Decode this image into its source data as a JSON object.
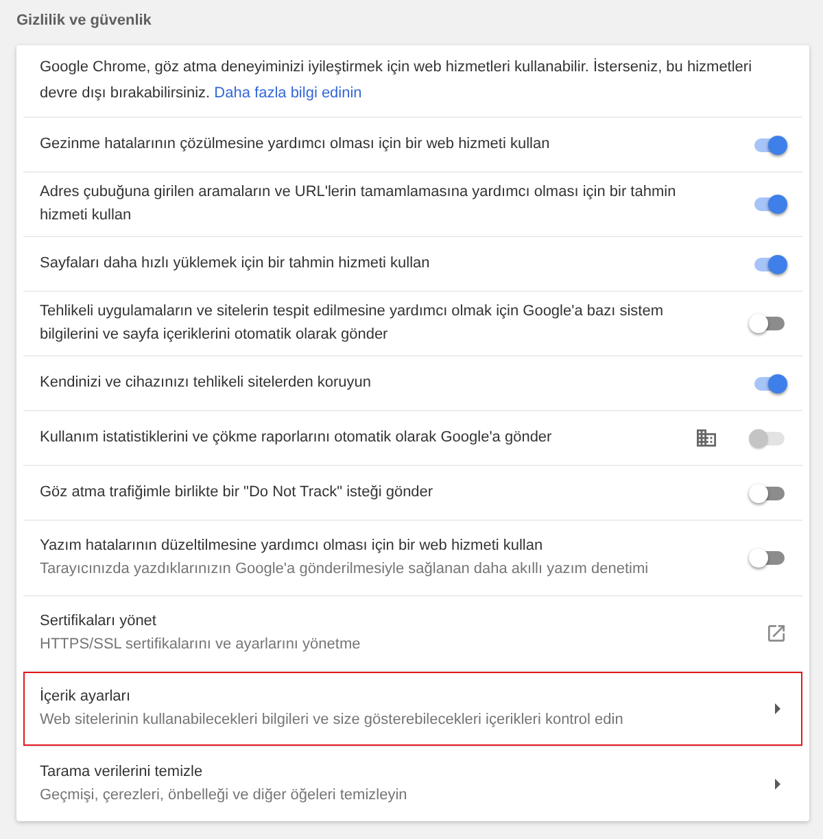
{
  "section": {
    "title": "Gizlilik ve güvenlik"
  },
  "intro": {
    "text": "Google Chrome, göz atma deneyiminizi iyileştirmek için web hizmetleri kullanabilir. İsterseniz, bu hizmetleri devre dışı bırakabilirsiniz.",
    "link": "Daha fazla bilgi edinin"
  },
  "rows": [
    {
      "kind": "toggle",
      "label": "Gezinme hatalarının çözülmesine yardımcı olması için bir web hizmeti kullan",
      "on": true,
      "disabled": false,
      "managed": false,
      "highlighted": false
    },
    {
      "kind": "toggle",
      "label": "Adres çubuğuna girilen aramaların ve URL'lerin tamamlamasına yardımcı olması için bir tahmin hizmeti kullan",
      "on": true,
      "disabled": false,
      "managed": false,
      "highlighted": false
    },
    {
      "kind": "toggle",
      "label": "Sayfaları daha hızlı yüklemek için bir tahmin hizmeti kullan",
      "on": true,
      "disabled": false,
      "managed": false,
      "highlighted": false
    },
    {
      "kind": "toggle",
      "label": "Tehlikeli uygulamaların ve sitelerin tespit edilmesine yardımcı olmak için Google'a bazı sistem bilgilerini ve sayfa içeriklerini otomatik olarak gönder",
      "on": false,
      "disabled": false,
      "managed": false,
      "highlighted": false
    },
    {
      "kind": "toggle",
      "label": "Kendinizi ve cihazınızı tehlikeli sitelerden koruyun",
      "on": true,
      "disabled": false,
      "managed": false,
      "highlighted": false
    },
    {
      "kind": "toggle",
      "label": "Kullanım istatistiklerini ve çökme raporlarını otomatik olarak Google'a gönder",
      "on": false,
      "disabled": true,
      "managed": true,
      "highlighted": false
    },
    {
      "kind": "toggle",
      "label": "Göz atma trafiğimle birlikte bir \"Do Not Track\" isteği gönder",
      "on": false,
      "disabled": false,
      "managed": false,
      "highlighted": false
    },
    {
      "kind": "toggle",
      "label": "Yazım hatalarının düzeltilmesine yardımcı olması için bir web hizmeti kullan",
      "description": "Tarayıcınızda yazdıklarınızın Google'a gönderilmesiyle sağlanan daha akıllı yazım denetimi",
      "on": false,
      "disabled": false,
      "managed": false,
      "highlighted": false
    },
    {
      "kind": "external",
      "label": "Sertifikaları yönet",
      "description": "HTTPS/SSL sertifikalarını ve ayarlarını yönetme",
      "highlighted": false
    },
    {
      "kind": "subpage",
      "label": "İçerik ayarları",
      "description": "Web sitelerinin kullanabilecekleri bilgileri ve size gösterebilecekleri içerikleri kontrol edin",
      "highlighted": true
    },
    {
      "kind": "subpage",
      "label": "Tarama verilerini temizle",
      "description": "Geçmişi, çerezleri, önbelleği ve diğer öğeleri temizleyin",
      "highlighted": false
    }
  ]
}
